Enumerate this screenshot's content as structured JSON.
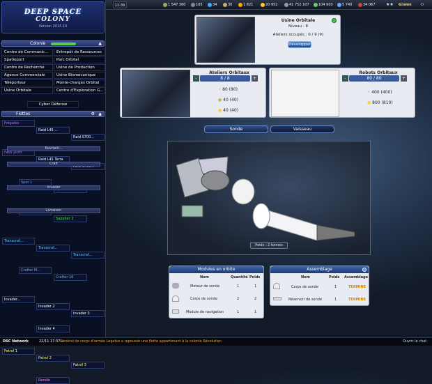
{
  "logo": {
    "line1": "DEEP SPACE",
    "line2": "COLONY",
    "version": "Version 2015.10"
  },
  "colony": {
    "header": "Colonie",
    "buildings": [
      "Centre de Communic...",
      "Entrepôt de Ressources",
      "Spatioport",
      "Parc Orbital",
      "Centre de Recherche",
      "Usine de Production",
      "Agence Commerciale",
      "Usine Biomécanique",
      "Téléporteur",
      "Monte-charges Orbital",
      "Usine Orbitale",
      "Centre d'Exploration G..."
    ],
    "cyber": "Cyber Défense"
  },
  "fleets": {
    "header": "Flottes",
    "row1": [
      "Frégates",
      "Raid L45 ...",
      "Raid S700..."
    ],
    "row2": [
      "Faux Jours",
      "Raid L45 Terra",
      "Raid S700..."
    ],
    "row3": [
      "Spot 1",
      "Spot 2"
    ],
    "sep1": "Ravitaill...",
    "row4": [
      "Supplier 1",
      "Supplier 2"
    ],
    "sep2": "Craft",
    "row5": [
      "Transcraf...",
      "Transcraf...",
      "Transcraf..."
    ],
    "row6": [
      "Crafter M...",
      "Crafter 16"
    ],
    "sep3": "Invader",
    "row7": [
      "Invader...",
      "Invader 2",
      "Invader 3"
    ],
    "row8": [
      "Invader 4"
    ],
    "sep4": "Livraison",
    "row9": [
      "Patrol 1",
      "Patrol 2",
      "Patrol 3"
    ],
    "row10": [
      "Rendle"
    ]
  },
  "topbar": {
    "time": "11:39",
    "resources": [
      "1 547 360",
      "105",
      "34",
      "30",
      "1 821",
      "20 952",
      "41 752 107",
      "104 903",
      "5 740",
      "34 067"
    ],
    "user": "Graïon"
  },
  "building": {
    "title": "Usine Orbitale",
    "level": "Niveau : 8",
    "workshops": "Ateliers occupés : 0 / 9 (9)",
    "upgrade_btn": "Développer"
  },
  "ateliers": {
    "title": "Ateliers Orbitaux",
    "count": "8 / 8",
    "costs": [
      "80 (80)",
      "40 (40)",
      "40 (40)"
    ]
  },
  "robots": {
    "title": "Robots Orbitaux",
    "count": "80 / 80",
    "costs": [
      "400 (400)",
      "800 (810)"
    ]
  },
  "tabs": {
    "sonde": "Sonde",
    "vaisseau": "Vaisseau"
  },
  "scene": {
    "weight": "Poids : 2 tonnes"
  },
  "modules": {
    "title": "Modules en orbite",
    "headers": [
      "Nom",
      "Quantité",
      "Poids"
    ],
    "rows": [
      {
        "name": "Moteur de sonde",
        "qty": "1",
        "w": "1"
      },
      {
        "name": "Corps de sonde",
        "qty": "2",
        "w": "2"
      },
      {
        "name": "Module de navigation",
        "qty": "1",
        "w": "1"
      }
    ]
  },
  "assembly": {
    "title": "Assemblage",
    "headers": [
      "Nom",
      "Poids",
      "Assemblage"
    ],
    "rows": [
      {
        "name": "Corps de sonde",
        "w": "1",
        "status": "TERMINE"
      },
      {
        "name": "Réservoir de sonde",
        "w": "1",
        "status": "TERMINE"
      }
    ]
  },
  "bottom": {
    "network": "DSC Network",
    "time": "22/11 17:37 »",
    "msg": "Général de corps d'armée Legatus a repoussé une flotte appartenant à la colonie Révolution",
    "chat": "Ouvrir le chat"
  },
  "colors": {
    "accent": "#3d66a8",
    "done": "#d08a00",
    "green": "#4c4"
  }
}
